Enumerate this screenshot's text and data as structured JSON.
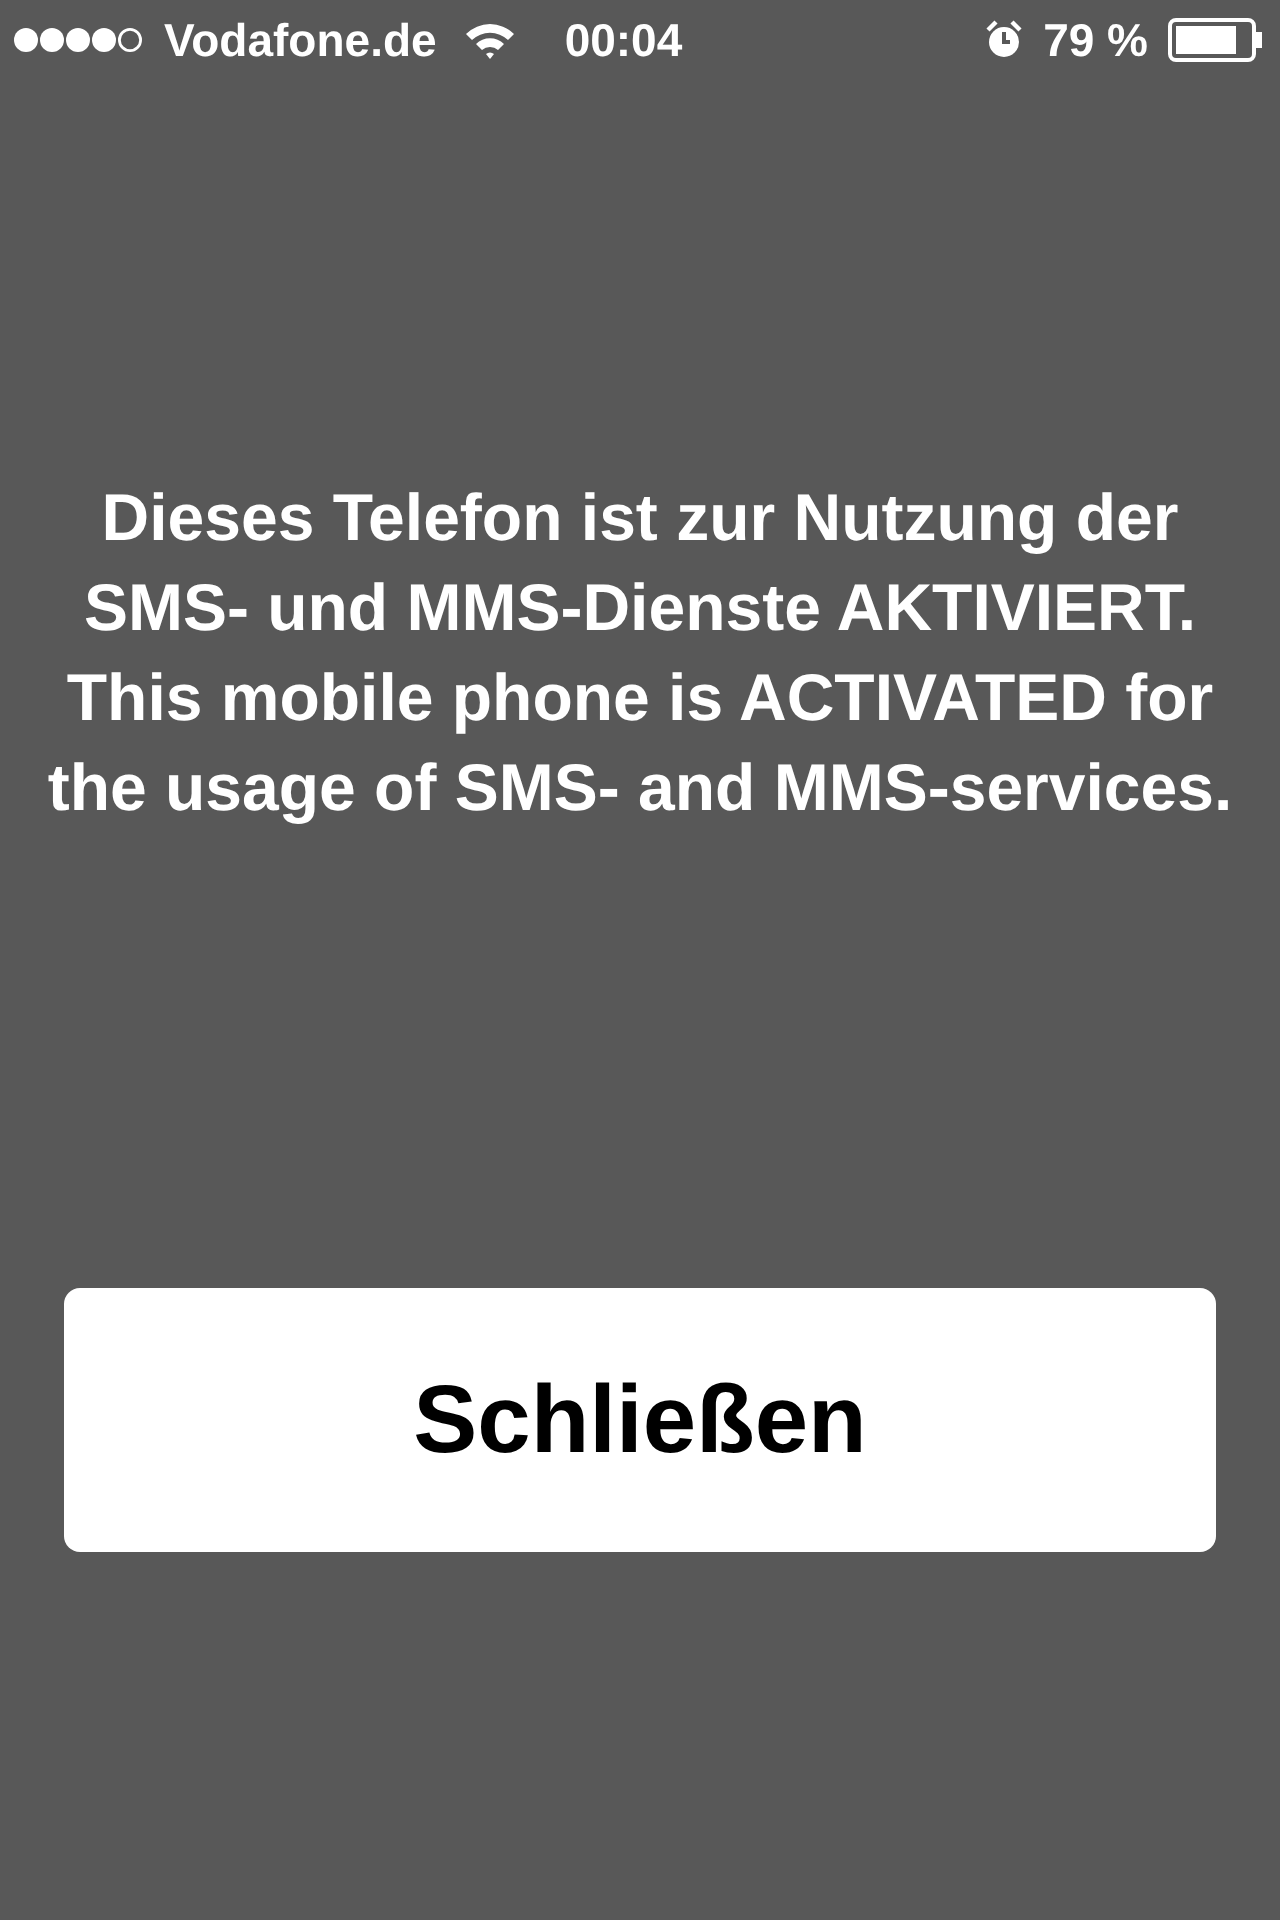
{
  "status_bar": {
    "carrier": "Vodafone.de",
    "time": "00:04",
    "battery": "79 %"
  },
  "message": "Dieses Telefon ist zur Nutzung der SMS- und MMS-Dienste AKTIVIERT. This mobile phone is ACTIVATED for the usage of SMS- and MMS-services.",
  "buttons": [
    "Schließen"
  ]
}
